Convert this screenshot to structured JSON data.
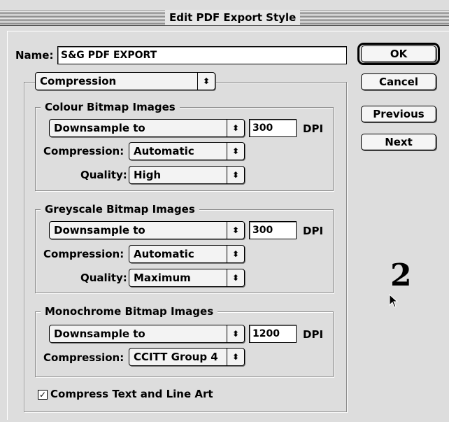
{
  "window": {
    "title": "Edit PDF Export Style"
  },
  "name_field": {
    "label": "Name:",
    "value": "S&G PDF EXPORT"
  },
  "buttons": {
    "ok": "OK",
    "cancel": "Cancel",
    "previous": "Previous",
    "next": "Next"
  },
  "section_popup": {
    "value": "Compression"
  },
  "colour": {
    "title": "Colour Bitmap Images",
    "downsample": "Downsample to",
    "dpi_value": "300",
    "dpi_label": "DPI",
    "compression_label": "Compression:",
    "compression_value": "Automatic",
    "quality_label": "Quality:",
    "quality_value": "High"
  },
  "greyscale": {
    "title": "Greyscale Bitmap Images",
    "downsample": "Downsample to",
    "dpi_value": "300",
    "dpi_label": "DPI",
    "compression_label": "Compression:",
    "compression_value": "Automatic",
    "quality_label": "Quality:",
    "quality_value": "Maximum"
  },
  "monochrome": {
    "title": "Monochrome Bitmap Images",
    "downsample": "Downsample to",
    "dpi_value": "1200",
    "dpi_label": "DPI",
    "compression_label": "Compression:",
    "compression_value": "CCITT Group 4"
  },
  "compress_text": {
    "label": "Compress Text and Line Art",
    "checked": true,
    "check_glyph": "✓"
  },
  "annotation": {
    "number": "2"
  },
  "icons": {
    "popup_arrows": "⬍",
    "cursor": "arrow-cursor-icon"
  }
}
